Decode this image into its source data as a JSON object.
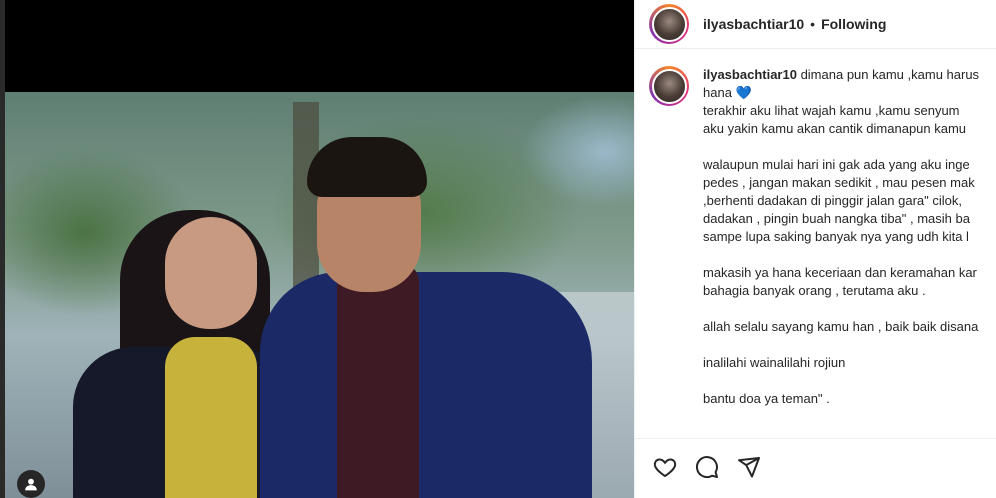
{
  "post": {
    "username": "ilyasbachtiar10",
    "follow_status": "Following",
    "separator": "•"
  },
  "caption": {
    "username": "ilyasbachtiar10",
    "lines": [
      " dimana pun kamu ,kamu harus",
      "hana",
      "terakhir aku lihat wajah kamu ,kamu senyum",
      "aku yakin kamu akan cantik dimanapun kamu",
      "walaupun mulai hari ini gak ada yang aku inge",
      "pedes , jangan makan sedikit , mau pesen mak",
      ",berhenti dadakan di pinggir jalan gara\" cilok,",
      "dadakan , pingin buah nangka tiba\" , masih ba",
      "sampe lupa saking banyak nya yang udh kita l",
      "makasih ya hana keceriaan dan keramahan kar",
      "bahagia banyak orang , terutama aku .",
      "allah selalu sayang kamu han , baik baik disana",
      "inalilahi wainalilahi rojiun",
      "bantu doa ya teman\" ."
    ],
    "heart_emoji": "💙"
  },
  "icons": {
    "like": "heart-outline-icon",
    "comment": "comment-bubble-icon",
    "share": "paper-plane-icon",
    "user_tag": "user-silhouette-icon"
  },
  "colors": {
    "text": "#262626",
    "border": "#efefef",
    "heart": "#3b8ad9"
  }
}
